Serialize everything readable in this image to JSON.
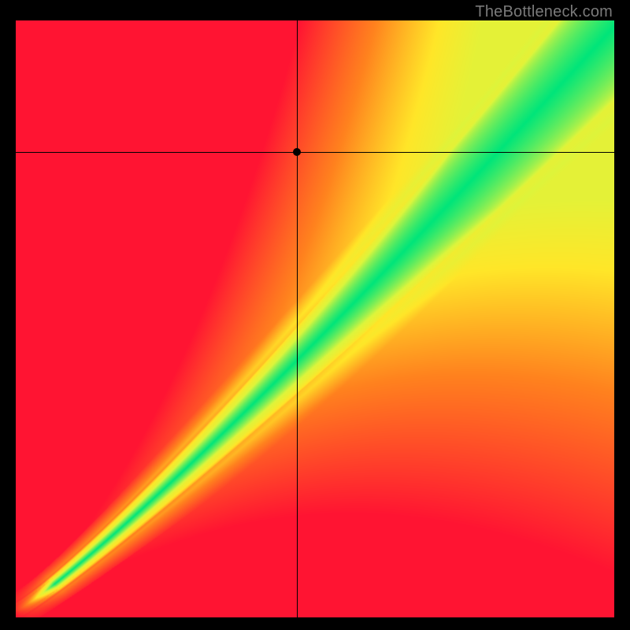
{
  "watermark": "TheBottleneck.com",
  "chart_data": {
    "type": "heatmap",
    "title": "",
    "xlabel": "",
    "ylabel": "",
    "xlim": [
      0,
      100
    ],
    "ylim": [
      0,
      100
    ],
    "colormap_description": "Red-Orange-Yellow-Green diagonal gradient; green optimal band along a curved diagonal where x≈y, shading through yellow to red as |x-y| increases. Bottom-left corner is red, top-right corner trends yellow-green.",
    "diagonal_band": {
      "description": "Bright green optimal region, curved roughly along y ≈ x^1.15 (slightly above the main diagonal in the lower half and below it in the upper-right), narrowing toward origin and widening toward upper-right.",
      "color": "#00E57A"
    },
    "crosshair": {
      "x": 47,
      "y": 78,
      "marker_color": "#000000"
    },
    "grid": false,
    "legend": false
  }
}
